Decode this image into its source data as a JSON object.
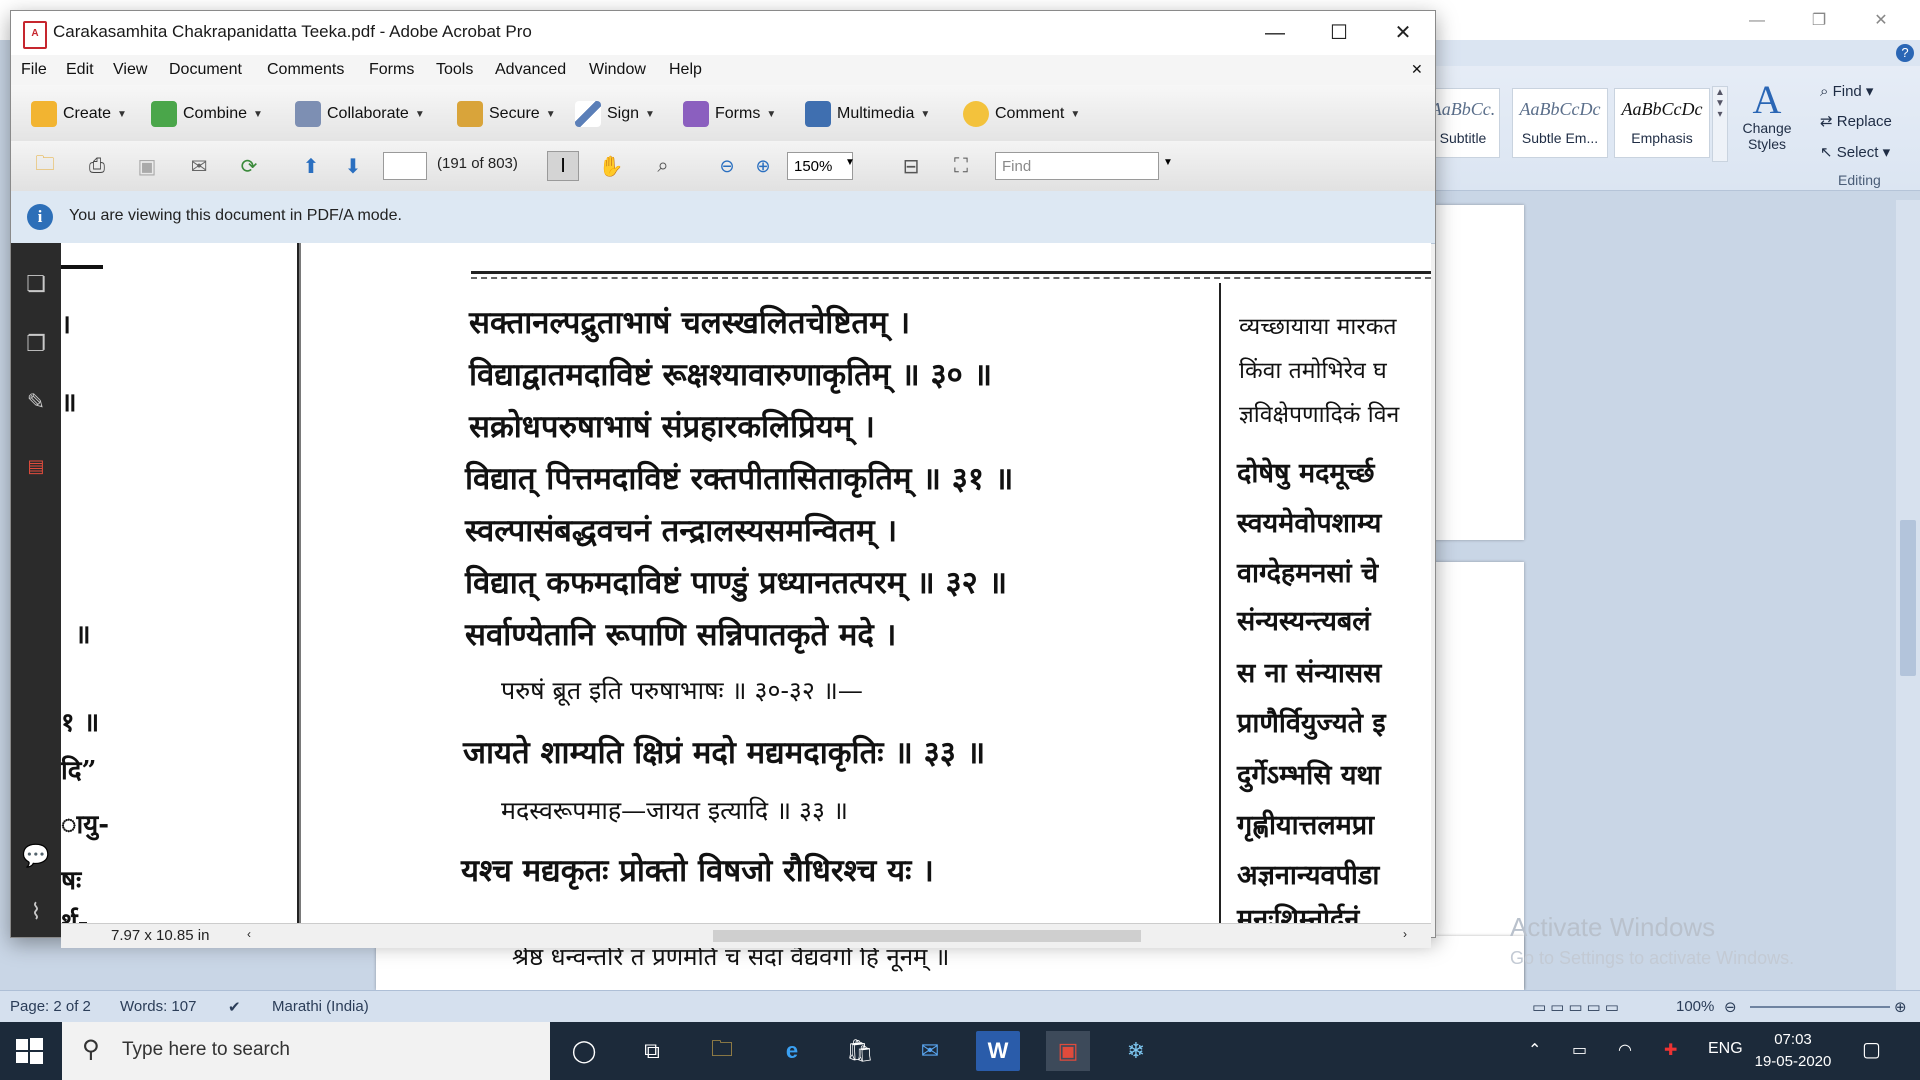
{
  "word": {
    "styles": [
      {
        "sample": "AaBbCc.",
        "name": "Subtitle"
      },
      {
        "sample": "AaBbCcDc",
        "name": "Subtle Em..."
      },
      {
        "sample": "AaBbCcDc",
        "name": "Emphasis"
      }
    ],
    "change_styles": "Change Styles",
    "find": "Find",
    "replace": "Replace",
    "select": "Select",
    "editing": "Editing",
    "doc_line": "श्रेष्ठ धन्वन्तरि तं प्रणमति च सदा वैद्यवर्गो हि नूनम् ॥",
    "status": {
      "page": "Page: 2 of 2",
      "words": "Words: 107",
      "language": "Marathi (India)",
      "zoom": "100%"
    },
    "watermark_title": "Activate Windows",
    "watermark_sub": "Go to Settings to activate Windows."
  },
  "acrobat": {
    "title": "Carakasamhita Chakrapanidatta Teeka.pdf - Adobe Acrobat Pro",
    "menu": [
      "File",
      "Edit",
      "View",
      "Document",
      "Comments",
      "Forms",
      "Tools",
      "Advanced",
      "Window",
      "Help"
    ],
    "toolbar": [
      "Create",
      "Combine",
      "Collaborate",
      "Secure",
      "Sign",
      "Forms",
      "Multimedia",
      "Comment"
    ],
    "page_total": "(191 of 803)",
    "zoom": "150%",
    "find_placeholder": "Find",
    "info": "You are viewing this document in PDF/A mode.",
    "page_size": "7.97 x 10.85 in",
    "colors": {
      "info_bg": "#dde8f3",
      "nav_bg": "#2b2b2b"
    }
  },
  "pdf": {
    "left_fragments": [
      "।",
      "॥",
      "॥",
      "१ ॥",
      "दि”",
      "ायु-",
      "षः",
      "र्थ-"
    ],
    "lines": [
      "सक्तानल्पद्रुताभाषं चलस्खलितचेष्टितम् ।",
      "विद्याद्वातमदाविष्टं रूक्षश्यावारुणाकृतिम् ॥ ३० ॥",
      "सक्रोधपरुषाभाषं संप्रहारकलिप्रियम् ।",
      "विद्यात् पित्तमदाविष्टं रक्तपीतासिताकृतिम् ॥ ३१ ॥",
      "स्वल्पासंबद्धवचनं तन्द्रालस्यसमन्वितम् ।",
      "विद्यात् कफमदाविष्टं पाण्डुं प्रध्यानतत्परम् ॥ ३२ ॥",
      "सर्वाण्येतानि रूपाणि सन्निपातकृते मदे ।",
      "परुषं ब्रूत इति परुषाभाषः ॥ ३०-३२ ॥—",
      "जायते शाम्यति क्षिप्रं मदो मद्यमदाकृतिः ॥ ३३ ॥",
      "मदस्वरूपमाह—जायत इत्यादि ॥ ३३ ॥",
      "यश्च मद्यकृतः प्रोक्तो विषजो रौधिरश्च यः ।"
    ],
    "right_col": [
      "व्यच्छायाया मारकत",
      "किंवा तमोभिरेव घ",
      "ज्ञविक्षेपणादिकं विन",
      "दोषेषु मदमूर्च्छ",
      "स्वयमेवोपशाम्य",
      "वाग्देहमनसां चे",
      "संन्यस्यन्त्यबलं",
      "स ना संन्यासस",
      "प्राणैर्वियुज्यते इ",
      "दुर्गेऽम्भसि यथा",
      "गृह्णीयात्तलमप्रा",
      "अज्ञनान्यवपीडा",
      "मनःशिम्नोर्दनं"
    ]
  },
  "taskbar": {
    "search_placeholder": "Type here to search",
    "lang": "ENG",
    "time": "07:03",
    "date": "19-05-2020"
  }
}
